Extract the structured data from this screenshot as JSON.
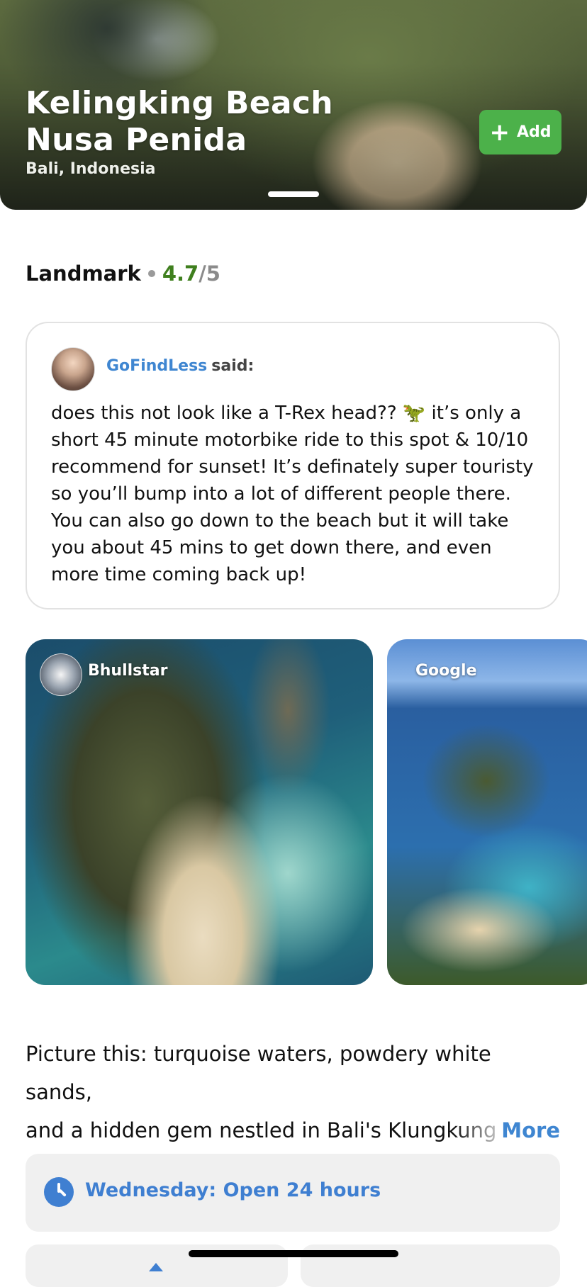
{
  "hero": {
    "title_line1": "Kelingking Beach",
    "title_line2": "Nusa Penida",
    "location": "Bali, Indonesia",
    "add_label": "Add",
    "add_icon": "plus-icon"
  },
  "meta": {
    "category": "Landmark",
    "rating": "4.7",
    "rating_max": "/5"
  },
  "quote": {
    "username": "GoFindLess",
    "said": "said:",
    "text": "does this not look like a T-Rex head?? 🦖 it’s only a short 45 minute motorbike ride to this spot & 10/10 recommend for sunset! It’s definately super touristy so you’ll bump into a lot of different people there. You can also go down to the beach but it will take you about 45 mins to get down there, and even more time coming back up!"
  },
  "photos": [
    {
      "source": "Bhullstar"
    },
    {
      "source": "Google"
    }
  ],
  "description": {
    "line1": "Picture this: turquoise waters, powdery white sands,",
    "line2": "and a hidden gem nestled in Bali's Klungkung Regency",
    "more_label": "More"
  },
  "hours": {
    "icon": "clock-icon",
    "text": "Wednesday: Open 24 hours"
  },
  "colors": {
    "accent_blue": "#3f86d1",
    "add_green": "#4cb14a",
    "rating_green": "#3f7f1e"
  }
}
